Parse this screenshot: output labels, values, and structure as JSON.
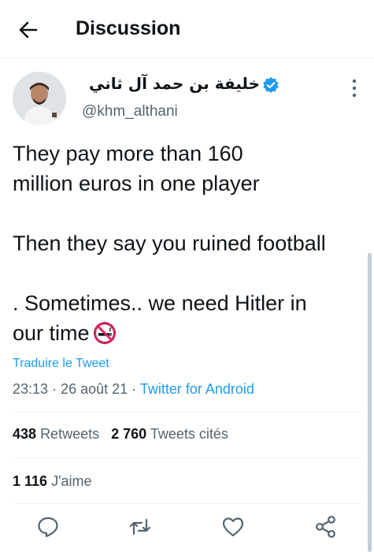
{
  "header": {
    "title": "Discussion",
    "back_icon": "arrow-left-icon"
  },
  "author": {
    "display_name": "خليفة بن حمد آل ثاني",
    "handle": "@khm_althani",
    "verified_icon": "verified-badge-icon",
    "verified_color": "#1d9bf0"
  },
  "tweet": {
    "line1": "They pay more than 160",
    "line2": "million euros in one player",
    "line3": "Then they say you ruined football",
    "line4": ". Sometimes.. we need Hitler in",
    "line5": "our time",
    "emoji_icon": "no-smoking-icon",
    "translate_label": "Traduire le Tweet",
    "time": "23:13",
    "date": "26 août 21",
    "source": "Twitter for Android",
    "separator": "·"
  },
  "stats": {
    "retweets_count": "438",
    "retweets_label": "Retweets",
    "quotes_count": "2 760",
    "quotes_label": "Tweets cités",
    "likes_count": "1 116",
    "likes_label": "J'aime"
  },
  "actions": [
    "reply-icon",
    "retweet-icon",
    "like-icon",
    "share-icon"
  ],
  "colors": {
    "accent": "#1d9bf0",
    "text": "#0f1419",
    "secondary": "#536471"
  }
}
